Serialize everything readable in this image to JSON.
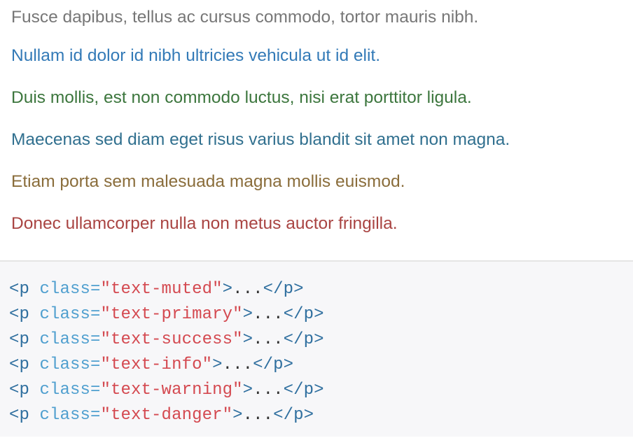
{
  "example": {
    "lines": [
      {
        "text": "Fusce dapibus, tellus ac cursus commodo, tortor mauris nibh.",
        "color": "#777777"
      },
      {
        "text": "Nullam id dolor id nibh ultricies vehicula ut id elit.",
        "color": "#337ab7"
      },
      {
        "text": "Duis mollis, est non commodo luctus, nisi erat porttitor ligula.",
        "color": "#3c763d"
      },
      {
        "text": "Maecenas sed diam eget risus varius blandit sit amet non magna.",
        "color": "#31708f"
      },
      {
        "text": "Etiam porta sem malesuada magna mollis euismod.",
        "color": "#8a6d3b"
      },
      {
        "text": "Donec ullamcorper nulla non metus auctor fringilla.",
        "color": "#a94442"
      }
    ]
  },
  "code": {
    "open_tag": "<p",
    "attr_name": " class=",
    "close_open": ">",
    "ellipsis": "...",
    "close_tag": "</p>",
    "lines": [
      {
        "class_value": "\"text-muted\""
      },
      {
        "class_value": "\"text-primary\""
      },
      {
        "class_value": "\"text-success\""
      },
      {
        "class_value": "\"text-info\""
      },
      {
        "class_value": "\"text-warning\""
      },
      {
        "class_value": "\"text-danger\""
      }
    ]
  },
  "colors": {
    "code_background": "#f7f7f9",
    "code_tag": "#2f6f9f",
    "code_attr": "#4f9fcf",
    "code_string": "#d44950",
    "divider": "#e5e5e5"
  }
}
